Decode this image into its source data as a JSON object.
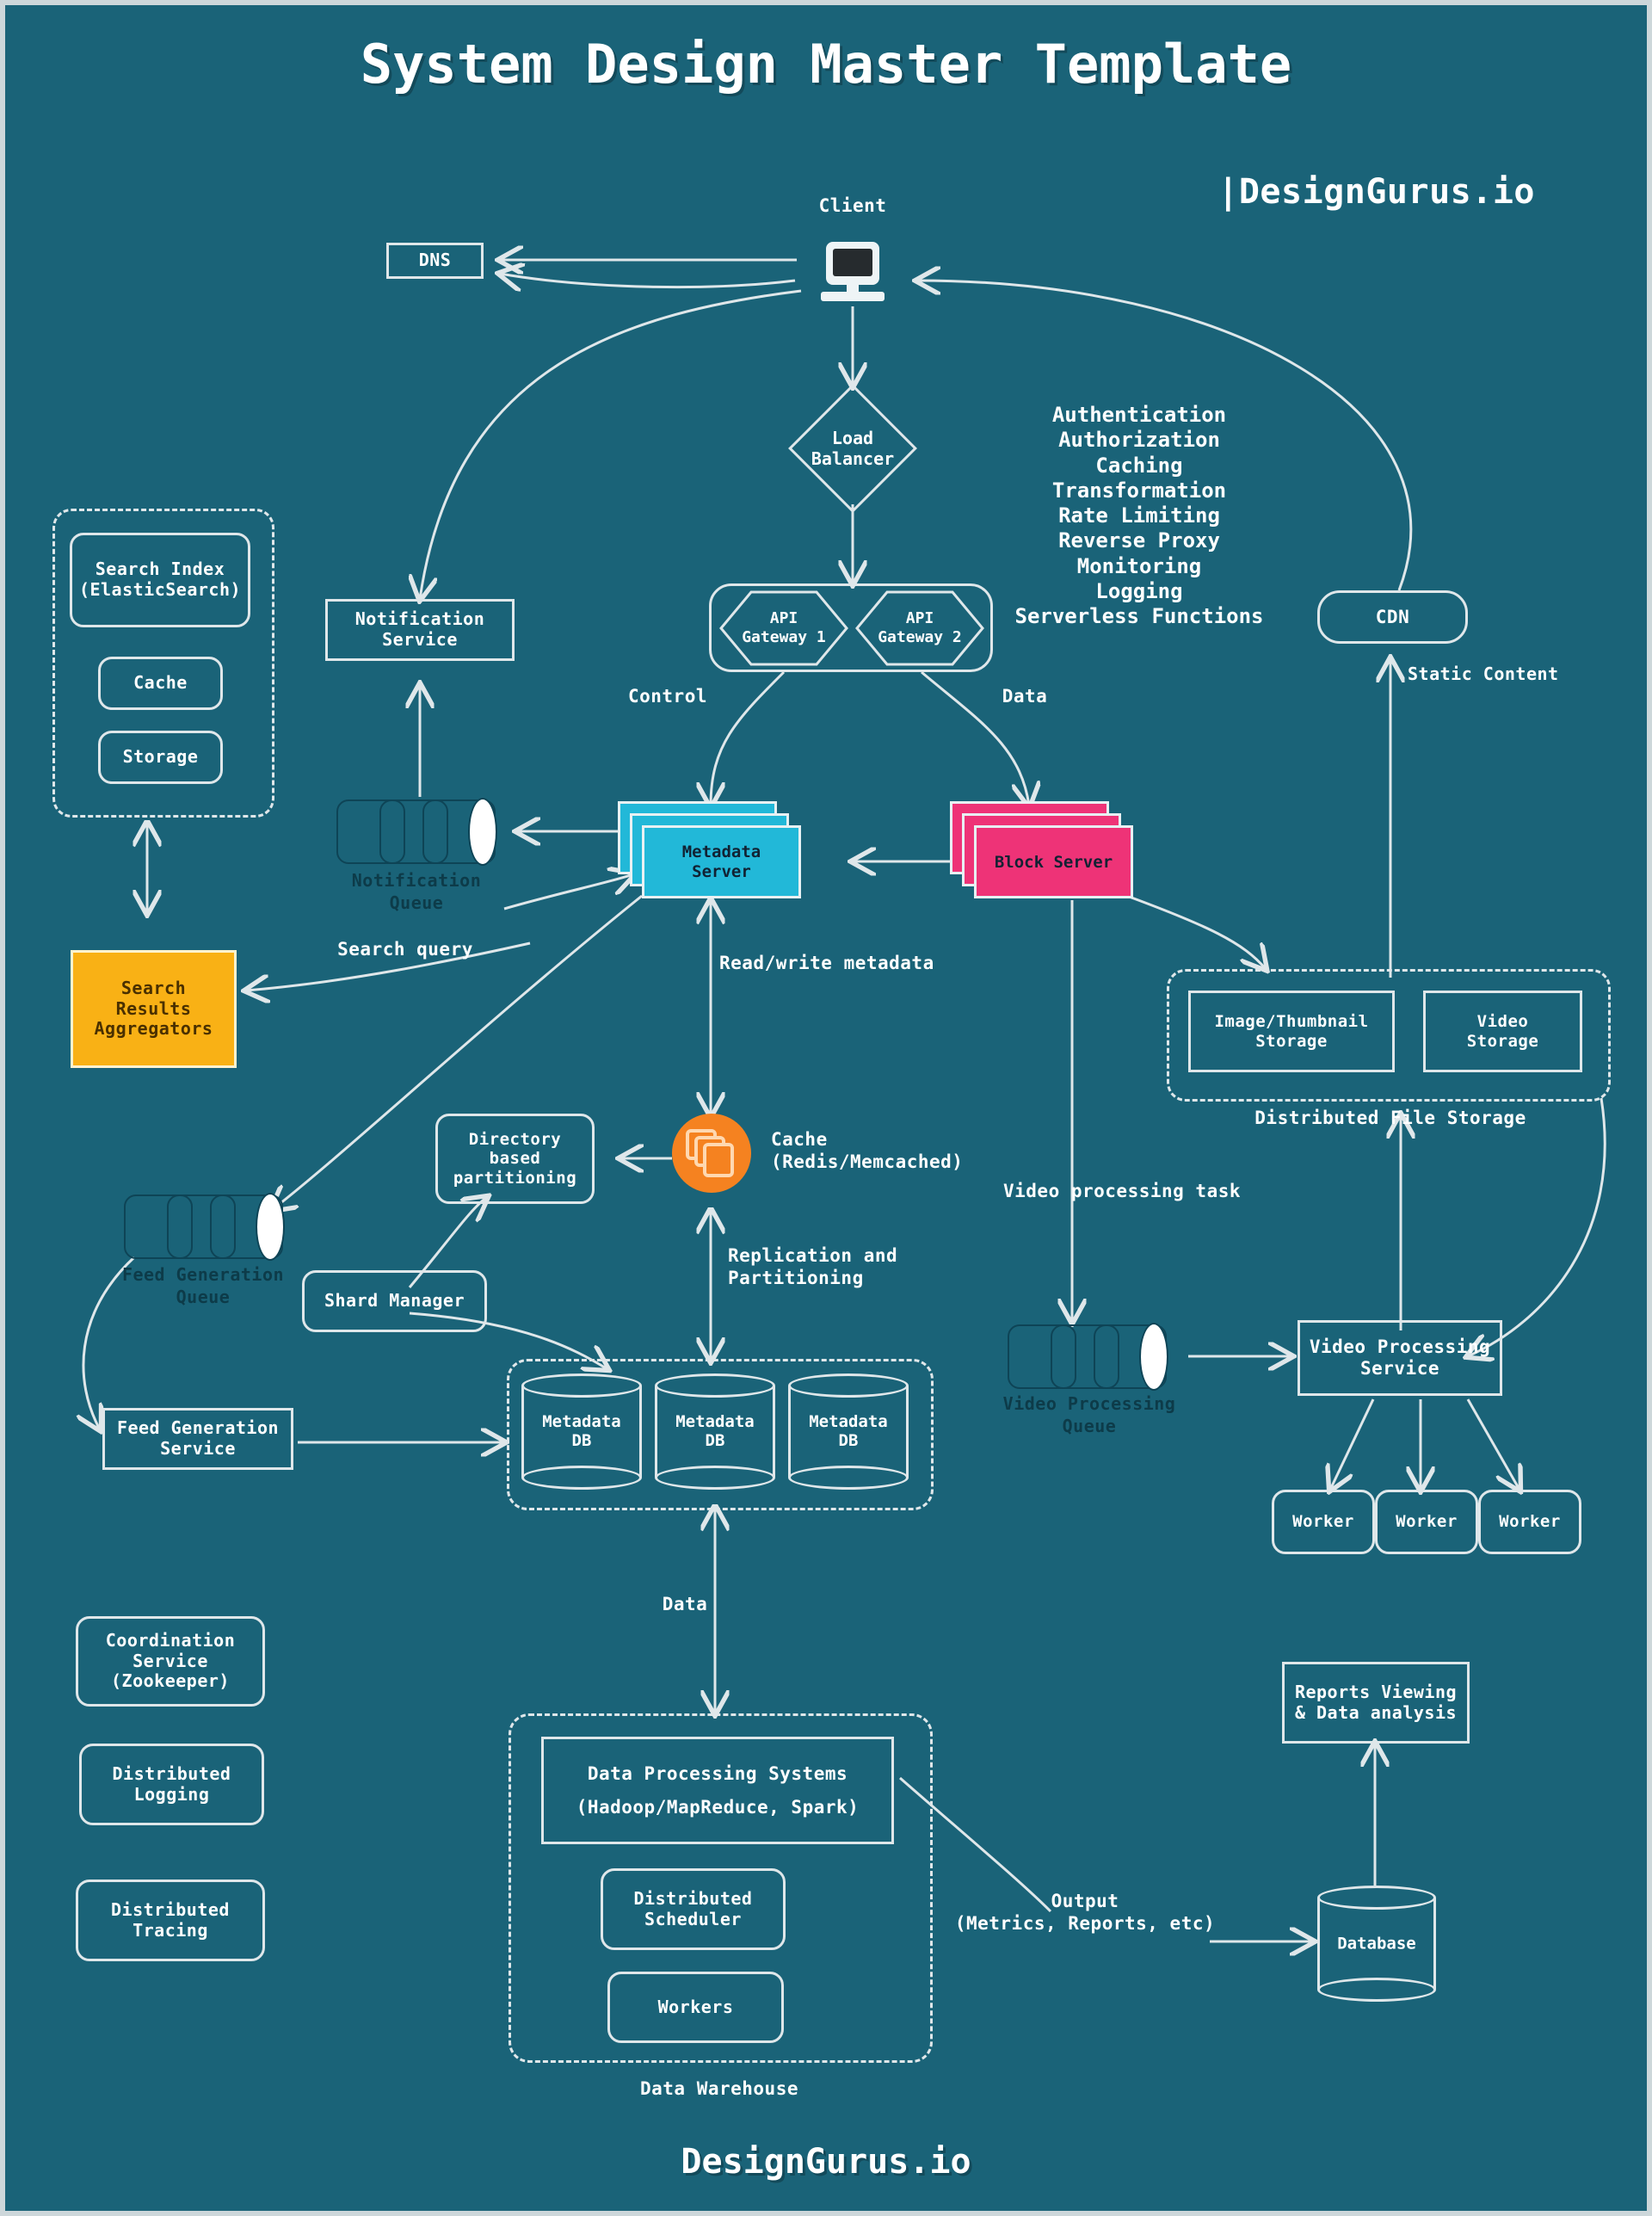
{
  "header": {
    "title": "System Design Master Template",
    "brand": "|DesignGurus.io"
  },
  "footer": {
    "brand": "DesignGurus.io"
  },
  "nodes": {
    "client": "Client",
    "dns": "DNS",
    "load_balancer": "Load\nBalancer",
    "api_gateway_1": "API\nGateway 1",
    "api_gateway_2": "API\nGateway 2",
    "cdn": "CDN",
    "notification_service": "Notification\nService",
    "notification_queue": "Notification\nQueue",
    "search_index": "Search Index\n(ElasticSearch)",
    "search_cache": "Cache",
    "search_storage": "Storage",
    "search_results_aggregators": "Search\nResults\nAggregators",
    "metadata_server": "Metadata\nServer",
    "block_server": "Block Server",
    "image_thumbnail_storage": "Image/Thumbnail\nStorage",
    "video_storage": "Video\nStorage",
    "distributed_file_storage": "Distributed File Storage",
    "directory_based_partitioning": "Directory\nbased\npartitioning",
    "cache": "Cache\n(Redis/Memcached)",
    "shard_manager": "Shard Manager",
    "feed_generation_queue": "Feed Generation\nQueue",
    "feed_generation_service": "Feed Generation\nService",
    "metadata_db_1": "Metadata\nDB",
    "metadata_db_2": "Metadata\nDB",
    "metadata_db_3": "Metadata\nDB",
    "video_processing_queue": "Video Processing\nQueue",
    "video_processing_service": "Video Processing\nService",
    "worker_1": "Worker",
    "worker_2": "Worker",
    "worker_3": "Worker",
    "coordination_service": "Coordination\nService\n(Zookeeper)",
    "distributed_logging": "Distributed\nLogging",
    "distributed_tracing": "Distributed\nTracing",
    "data_processing_systems": "Data Processing Systems",
    "data_processing_systems_sub": "(Hadoop/MapReduce, Spark)",
    "distributed_scheduler": "Distributed\nScheduler",
    "dw_workers": "Workers",
    "data_warehouse": "Data Warehouse",
    "reports_viewing": "Reports Viewing\n& Data analysis",
    "database": "Database"
  },
  "gateway_features": [
    "Authentication",
    "Authorization",
    "Caching",
    "Transformation",
    "Rate Limiting",
    "Reverse Proxy",
    "Monitoring",
    "Logging",
    "Serverless Functions"
  ],
  "edge_labels": {
    "control": "Control",
    "data": "Data",
    "static_content": "Static Content",
    "search_query": "Search query",
    "read_write_metadata": "Read/write metadata",
    "replication_partitioning": "Replication and\nPartitioning",
    "video_processing_task": "Video processing task",
    "data_flow": "Data",
    "output": "Output\n(Metrics, Reports, etc)"
  },
  "colors": {
    "background": "#1a6378",
    "stroke": "#dfe7ea",
    "metadata_server": "#22b8d8",
    "block_server": "#ee3377",
    "search_results_aggregators": "#f9b115",
    "cache": "#f58220",
    "text": "#ffffff",
    "muted_text": "#0d3b49"
  }
}
